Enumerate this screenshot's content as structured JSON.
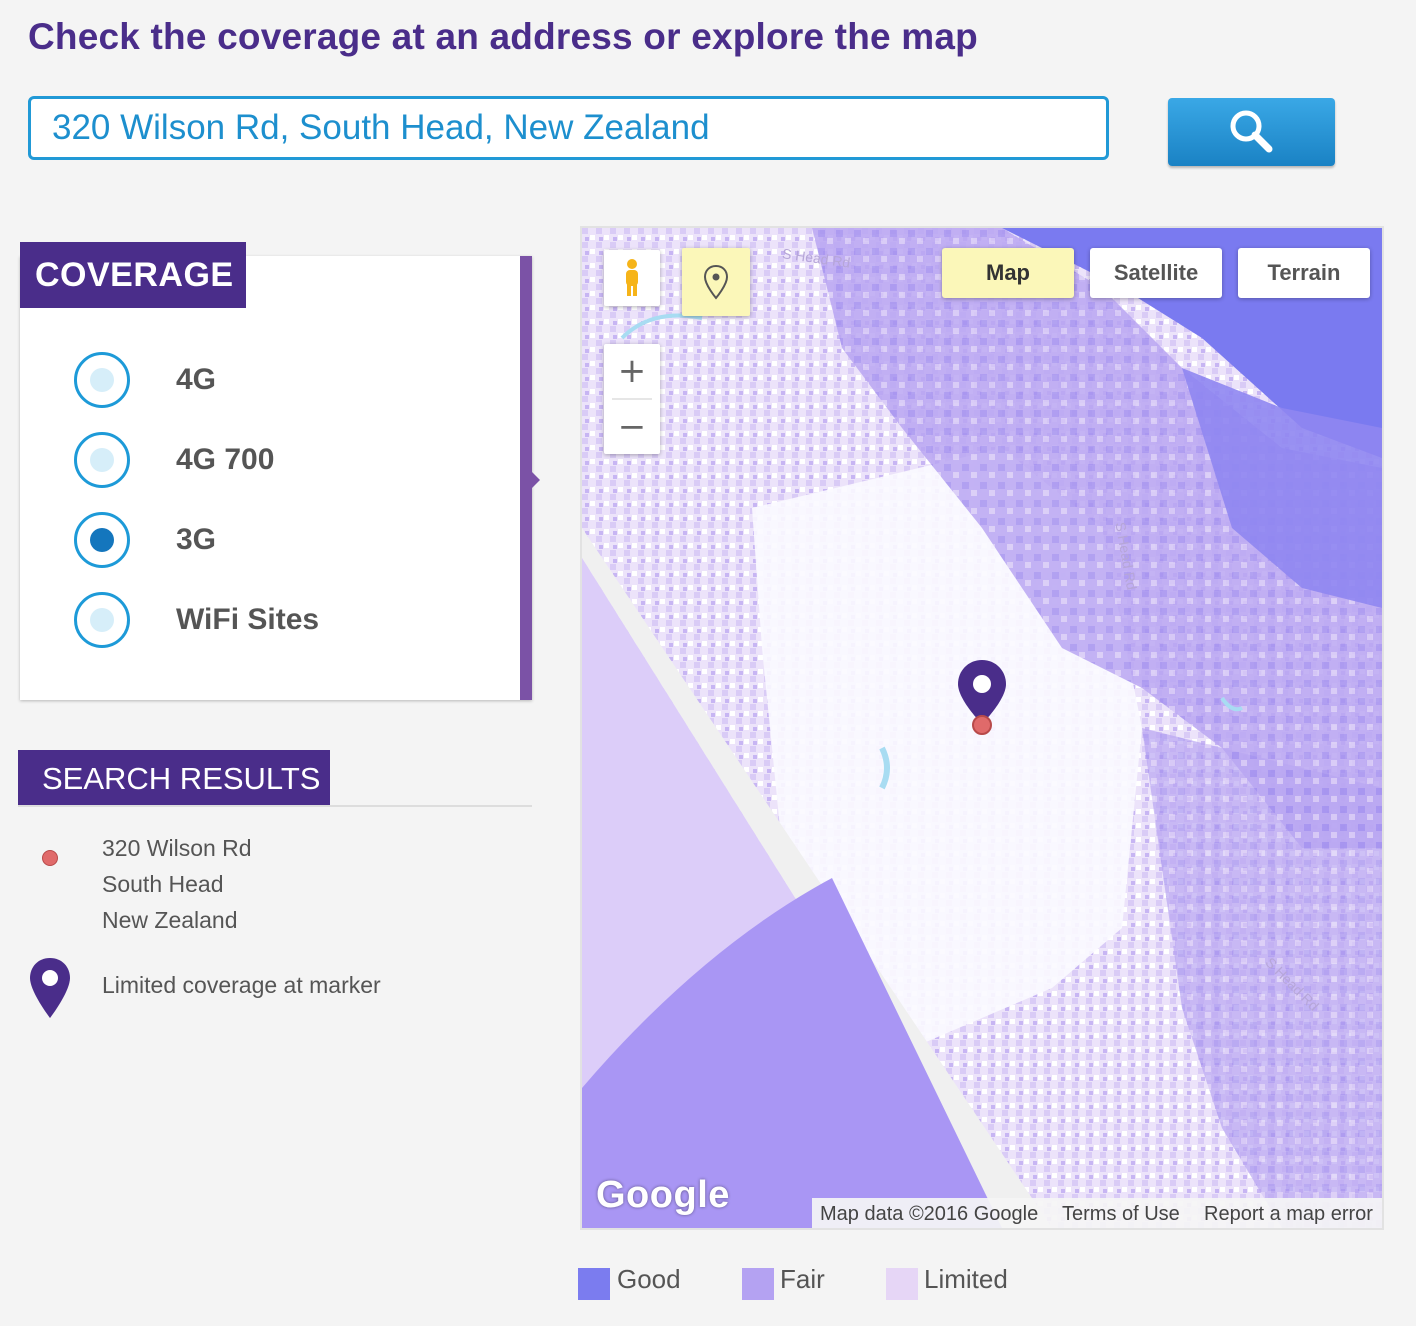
{
  "heading": "Check the coverage at an address or explore the map",
  "search": {
    "value": "320 Wilson Rd, South Head, New Zealand",
    "button_icon": "search-icon"
  },
  "coverage": {
    "title": "COVERAGE",
    "options": [
      {
        "label": "4G",
        "checked": false
      },
      {
        "label": "4G 700",
        "checked": false
      },
      {
        "label": "3G",
        "checked": true
      },
      {
        "label": "WiFi Sites",
        "checked": false
      }
    ]
  },
  "results": {
    "title": "SEARCH RESULTS",
    "address": [
      "320 Wilson Rd",
      "South Head",
      "New Zealand"
    ],
    "marker_text": "Limited coverage at marker"
  },
  "map": {
    "map_types": [
      {
        "label": "Map",
        "active": true
      },
      {
        "label": "Satellite",
        "active": false
      },
      {
        "label": "Terrain",
        "active": false
      }
    ],
    "zoom_in": "+",
    "zoom_out": "−",
    "logo": "Google",
    "attribution": {
      "data": "Map data ©2016 Google",
      "terms": "Terms of Use",
      "report": "Report a map error"
    },
    "road_labels": [
      "S Head Rd",
      "S Head Rd",
      "S Head Rd"
    ]
  },
  "legend": [
    {
      "label": "Good",
      "color": "#7b7cef"
    },
    {
      "label": "Fair",
      "color": "#b4a2f2"
    },
    {
      "label": "Limited",
      "color": "#e6d6f6"
    }
  ],
  "colors": {
    "brand_purple": "#4a2d8a",
    "accent_blue": "#2199d6",
    "marker_red": "#e06a6a"
  }
}
